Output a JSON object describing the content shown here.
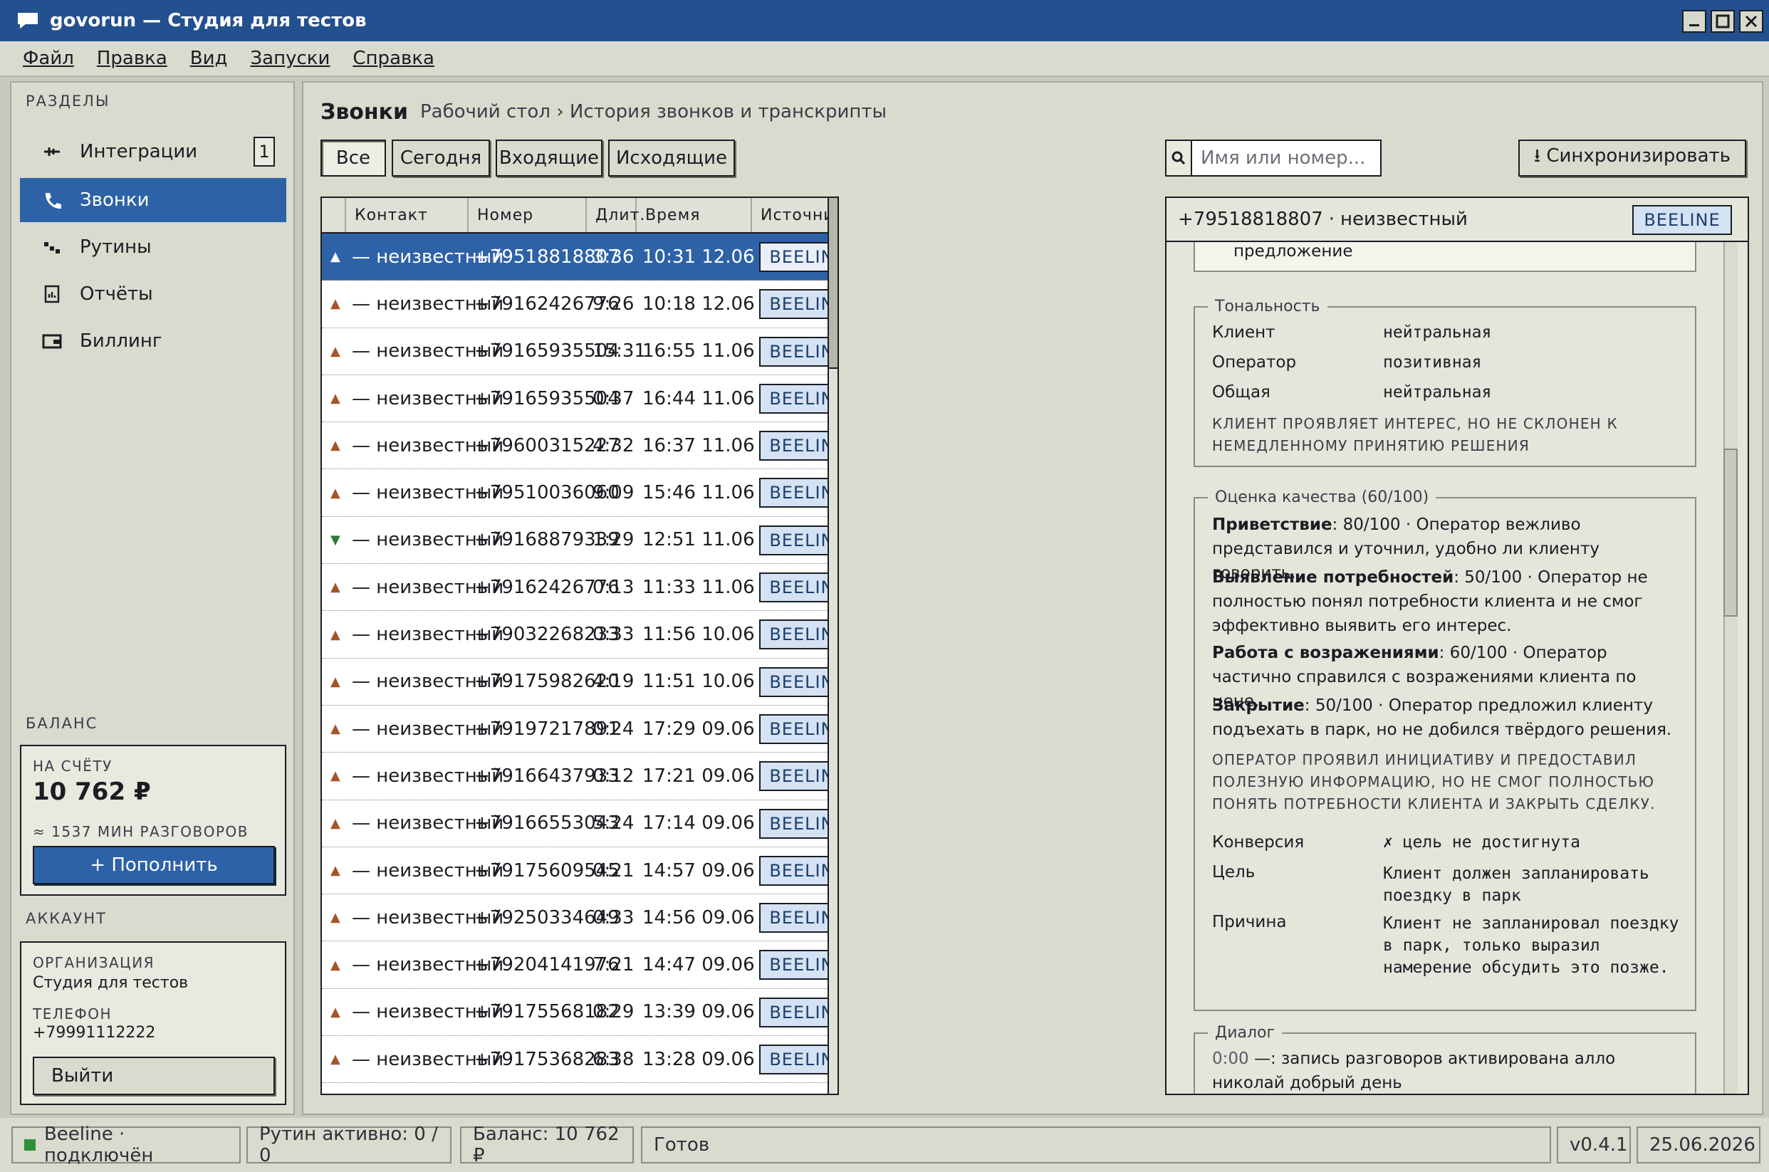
{
  "window": {
    "title": "govorun — Студия для тестов"
  },
  "menu": [
    "Файл",
    "Правка",
    "Вид",
    "Запуски",
    "Справка"
  ],
  "sidebar": {
    "sections_label": "РАЗДЕЛЫ",
    "items": [
      {
        "label": "Интеграции",
        "icon": "plug-icon",
        "badge": "1"
      },
      {
        "label": "Звонки",
        "icon": "phone-icon",
        "active": true
      },
      {
        "label": "Рутины",
        "icon": "routine-icon"
      },
      {
        "label": "Отчёты",
        "icon": "report-icon"
      },
      {
        "label": "Биллинг",
        "icon": "wallet-icon"
      }
    ],
    "balance_label": "БАЛАНС",
    "balance": {
      "on_account_label": "НА СЧЁТУ",
      "amount": "10 762 ₽",
      "minutes": "≈ 1537 МИН РАЗГОВОРОВ",
      "topup_button": "+ Пополнить"
    },
    "account_label": "АККАУНТ",
    "account": {
      "org_label": "ОРГАНИЗАЦИЯ",
      "org": "Студия для тестов",
      "phone_label": "ТЕЛЕФОН",
      "phone": "+79991112222",
      "logout_button": "Выйти"
    }
  },
  "main": {
    "title": "Звонки",
    "breadcrumb": "Рабочий стол › История звонков и транскрипты",
    "filters": [
      "Все",
      "Сегодня",
      "Входящие",
      "Исходящие"
    ],
    "search_placeholder": "Имя или номер...",
    "sync_button": "⭳ Синхронизировать",
    "columns": [
      "Контакт",
      "Номер",
      "Длит.",
      "Время",
      "Источник"
    ],
    "rows": [
      {
        "dir": "out",
        "contact": "— неизвестный",
        "number": "+79518818807",
        "dur": "3:36",
        "time": "10:31 12.06",
        "source": "BEELINE",
        "selected": true
      },
      {
        "dir": "out",
        "contact": "— неизвестный",
        "number": "+79162426776",
        "dur": "9:26",
        "time": "10:18 12.06",
        "source": "BEELINE"
      },
      {
        "dir": "out",
        "contact": "— неизвестный",
        "number": "+79165935504",
        "dur": "15:31",
        "time": "16:55 11.06",
        "source": "BEELINE"
      },
      {
        "dir": "out",
        "contact": "— неизвестный",
        "number": "+79165935504",
        "dur": "0:37",
        "time": "16:44 11.06",
        "source": "BEELINE"
      },
      {
        "dir": "out",
        "contact": "— неизвестный",
        "number": "+79600315227",
        "dur": "4:32",
        "time": "16:37 11.06",
        "source": "BEELINE"
      },
      {
        "dir": "out",
        "contact": "— неизвестный",
        "number": "+79510036060",
        "dur": "9:09",
        "time": "15:46 11.06",
        "source": "BEELINE"
      },
      {
        "dir": "in",
        "contact": "— неизвестный",
        "number": "+79168879339",
        "dur": "1:29",
        "time": "12:51 11.06",
        "source": "BEELINE"
      },
      {
        "dir": "out",
        "contact": "— неизвестный",
        "number": "+79162426776",
        "dur": "0:13",
        "time": "11:33 11.06",
        "source": "BEELINE"
      },
      {
        "dir": "out",
        "contact": "— неизвестный",
        "number": "+79032268233",
        "dur": "0:33",
        "time": "11:56 10.06",
        "source": "BEELINE"
      },
      {
        "dir": "out",
        "contact": "— неизвестный",
        "number": "+79175982620",
        "dur": "4:19",
        "time": "11:51 10.06",
        "source": "BEELINE"
      },
      {
        "dir": "out",
        "contact": "— неизвестный",
        "number": "+79197217891",
        "dur": "0:24",
        "time": "17:29 09.06",
        "source": "BEELINE"
      },
      {
        "dir": "out",
        "contact": "— неизвестный",
        "number": "+79166437933",
        "dur": "0:12",
        "time": "17:21 09.06",
        "source": "BEELINE"
      },
      {
        "dir": "out",
        "contact": "— неизвестный",
        "number": "+79166553043",
        "dur": "5:24",
        "time": "17:14 09.06",
        "source": "BEELINE"
      },
      {
        "dir": "out",
        "contact": "— неизвестный",
        "number": "+79175609545",
        "dur": "0:21",
        "time": "14:57 09.06",
        "source": "BEELINE"
      },
      {
        "dir": "out",
        "contact": "— неизвестный",
        "number": "+79250334649",
        "dur": "0:33",
        "time": "14:56 09.06",
        "source": "BEELINE"
      },
      {
        "dir": "out",
        "contact": "— неизвестный",
        "number": "+79204141976",
        "dur": "7:21",
        "time": "14:47 09.06",
        "source": "BEELINE"
      },
      {
        "dir": "out",
        "contact": "— неизвестный",
        "number": "+79175568182",
        "dur": "0:29",
        "time": "13:39 09.06",
        "source": "BEELINE"
      },
      {
        "dir": "out",
        "contact": "— неизвестный",
        "number": "+79175368283",
        "dur": "6:38",
        "time": "13:28 09.06",
        "source": "BEELINE"
      }
    ]
  },
  "detail": {
    "number": "+79518818807",
    "separator": "·",
    "contact": "неизвестный",
    "source": "BEELINE",
    "summary_tail": "предложение",
    "tone": {
      "label": "Тональность",
      "client_label": "Клиент",
      "client": "нейтральная",
      "operator_label": "Оператор",
      "operator": "позитивная",
      "overall_label": "Общая",
      "overall": "нейтральная",
      "note": "КЛИЕНТ ПРОЯВЛЯЕТ ИНТЕРЕС, НО НЕ СКЛОНЕН К НЕМЕДЛЕННОМУ ПРИНЯТИЮ РЕШЕНИЯ"
    },
    "quality": {
      "label": "Оценка качества (60/100)",
      "items": [
        {
          "name": "Приветствие",
          "score": ": 80/100",
          "text": " · Оператор вежливо представился и уточнил, удобно ли клиенту говорить."
        },
        {
          "name": "Выявление потребностей",
          "score": ": 50/100",
          "text": " · Оператор не полностью понял потребности клиента и не смог эффективно выявить его интерес."
        },
        {
          "name": "Работа с возражениями",
          "score": ": 60/100",
          "text": " · Оператор частично справился с возражениями клиента по цене."
        },
        {
          "name": "Закрытие",
          "score": ": 50/100",
          "text": " · Оператор предложил клиенту подъехать в парк, но не добился твёрдого решения."
        }
      ],
      "note": "ОПЕРАТОР ПРОЯВИЛ ИНИЦИАТИВУ И ПРЕДОСТАВИЛ ПОЛЕЗНУЮ ИНФОРМАЦИЮ, НО НЕ СМОГ ПОЛНОСТЬЮ ПОНЯТЬ ПОТРЕБНОСТИ КЛИЕНТА И ЗАКРЫТЬ СДЕЛКУ.",
      "conversion_label": "Конверсия",
      "conversion": "✗ цель не достигнута",
      "goal_label": "Цель",
      "goal": "Клиент должен запланировать поездку в парк",
      "reason_label": "Причина",
      "reason": "Клиент не запланировал поездку в парк, только выразил намерение обсудить это позже."
    },
    "dialog": {
      "label": "Диалог",
      "first_time": "0:00",
      "first_text": " —: запись разговоров активирована алло николай добрый день"
    }
  },
  "status": {
    "connection": "Beeline · подключён",
    "routines": "Рутин активно: 0 / 0",
    "balance": "Баланс: 10 762 ₽",
    "state": "Готов",
    "version": "v0.4.1",
    "date": "25.06.2026"
  },
  "colors": {
    "accent": "#2e62a7",
    "titlebar": "#23508f",
    "outgoing": "#a4562a",
    "incoming": "#2f7a3a",
    "tag_bg": "#d4e2f3"
  }
}
